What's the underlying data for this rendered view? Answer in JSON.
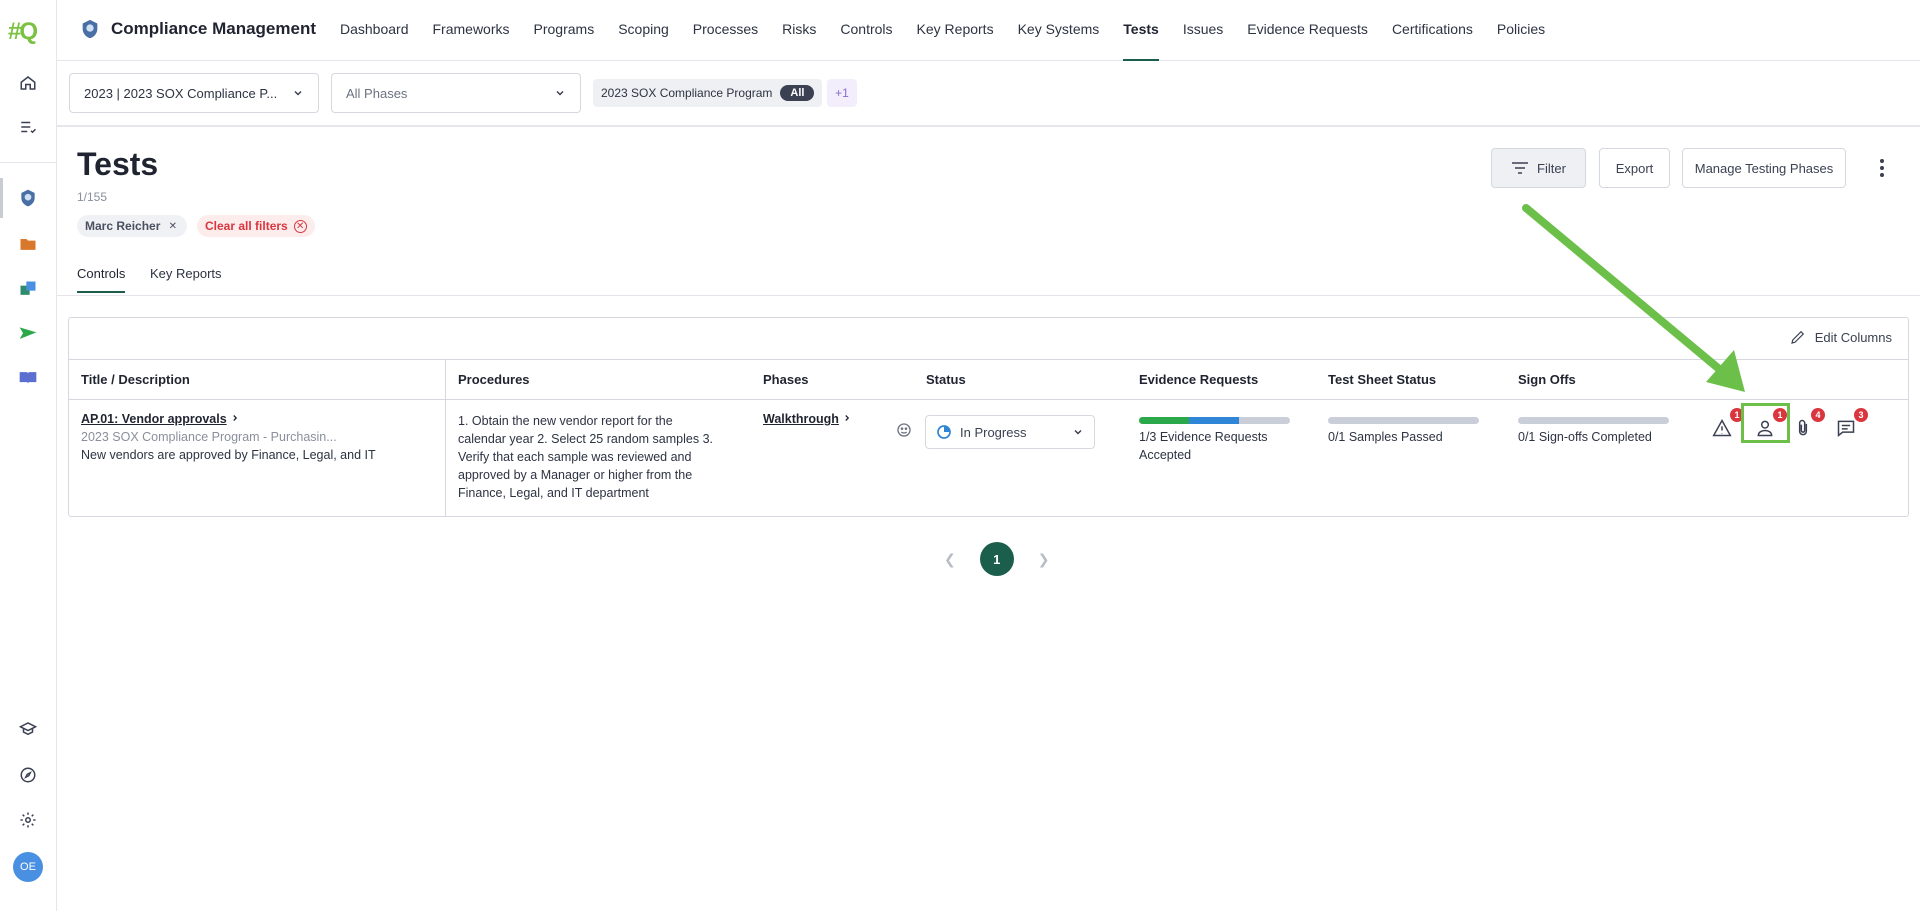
{
  "app": {
    "logo_text": "#Q",
    "title": "Compliance Management"
  },
  "nav": {
    "items": [
      "Dashboard",
      "Frameworks",
      "Programs",
      "Scoping",
      "Processes",
      "Risks",
      "Controls",
      "Key Reports",
      "Key Systems",
      "Tests",
      "Issues",
      "Evidence Requests",
      "Certifications",
      "Policies"
    ],
    "active": "Tests"
  },
  "filterbar": {
    "program_select": "2023 | 2023 SOX Compliance P...",
    "phase_select": "All Phases",
    "program_chip": "2023 SOX Compliance Program",
    "program_chip_badge": "All",
    "more_chip": "+1"
  },
  "page": {
    "title": "Tests",
    "count": "1/155",
    "filter_chip_user": "Marc Reicher",
    "clear_filters": "Clear all filters",
    "filter_btn": "Filter",
    "export_btn": "Export",
    "manage_btn": "Manage Testing Phases"
  },
  "tabs": [
    "Controls",
    "Key Reports"
  ],
  "table": {
    "edit_columns": "Edit Columns",
    "headers": [
      "Title / Description",
      "Procedures",
      "Phases",
      "Status",
      "Evidence Requests",
      "Test Sheet Status",
      "Sign Offs"
    ],
    "row": {
      "title": "AP.01: Vendor approvals",
      "subtitle": "2023 SOX Compliance Program - Purchasin...",
      "description": "New vendors are approved by Finance, Legal, and IT",
      "procedures": "1. Obtain the new vendor report for the calendar year 2. Select 25 random samples 3. Verify that each sample was reviewed and approved by a Manager or higher from the Finance, Legal, and IT department",
      "phase": "Walkthrough",
      "status": "In Progress",
      "evidence_text": "1/3 Evidence Requests Accepted",
      "evidence_green_fraction": 0.33,
      "evidence_blue_fraction": 0.33,
      "test_sheet_text": "0/1 Samples Passed",
      "signoffs_text": "0/1 Sign-offs Completed",
      "badges": {
        "issues": "1",
        "reviewers": "1",
        "attachments": "4",
        "comments": "3"
      }
    }
  },
  "pagination": {
    "current": "1"
  },
  "user": {
    "initials": "OE"
  },
  "colors": {
    "accent": "#1b5e4b",
    "badge": "#d9363e",
    "highlight": "#6cc04a"
  }
}
